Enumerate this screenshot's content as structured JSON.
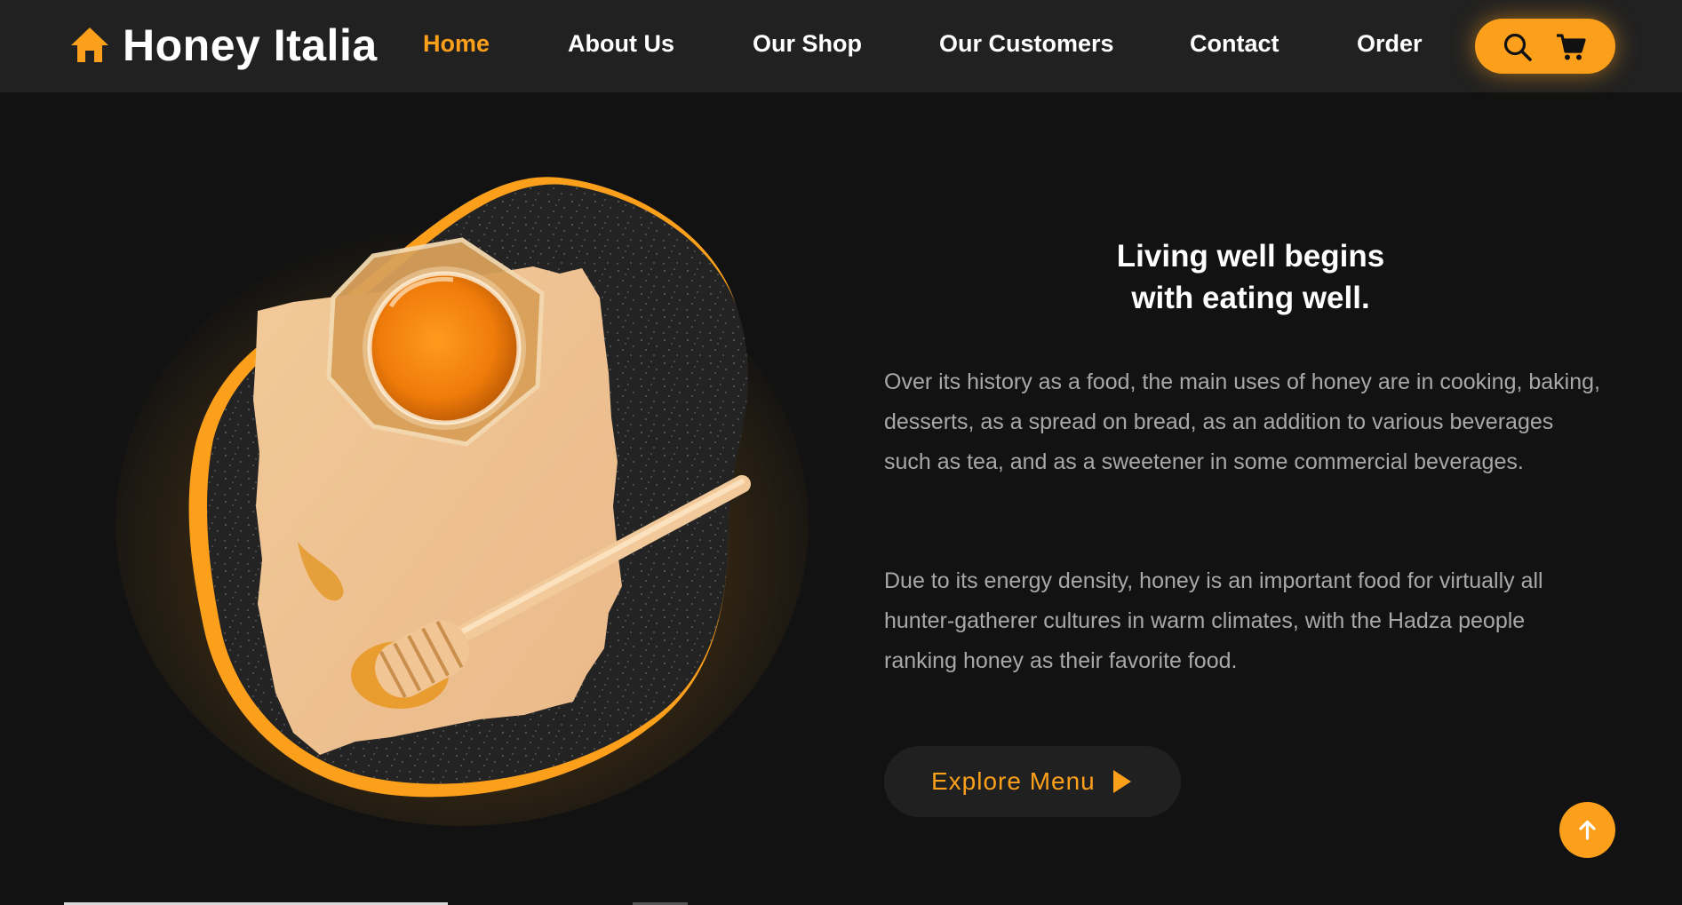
{
  "colors": {
    "accent": "#fca01c",
    "background": "#121212",
    "header_background": "#212121",
    "button_background": "#202020",
    "text_primary": "#ffffff",
    "text_secondary": "#a8a8a8"
  },
  "header": {
    "logo_icon": "house-icon",
    "brand": "Honey Italia",
    "nav": [
      {
        "label": "Home",
        "active": true
      },
      {
        "label": "About Us",
        "active": false
      },
      {
        "label": "Our Shop",
        "active": false
      },
      {
        "label": "Our Customers",
        "active": false
      },
      {
        "label": "Contact",
        "active": false
      },
      {
        "label": "Order",
        "active": false
      }
    ],
    "actions": [
      {
        "icon": "search-icon"
      },
      {
        "icon": "cart-icon"
      }
    ]
  },
  "hero": {
    "image": "honey-jar-with-dipper-on-paper",
    "headline_line1": "Living well begins",
    "headline_line2": "with eating well.",
    "paragraph1": "Over its history as a food, the main uses of honey are in cooking, baking, desserts, as a spread on bread, as an addition to various beverages such as tea, and as a sweetener in some commercial beverages.",
    "paragraph2": "Due to its energy density, honey is an important food for virtually all hunter-gatherer cultures in warm climates, with the Hadza people ranking honey as their favorite food.",
    "cta_label": "Explore Menu",
    "cta_icon": "play-icon"
  },
  "back_to_top": {
    "icon": "arrow-up-icon"
  }
}
